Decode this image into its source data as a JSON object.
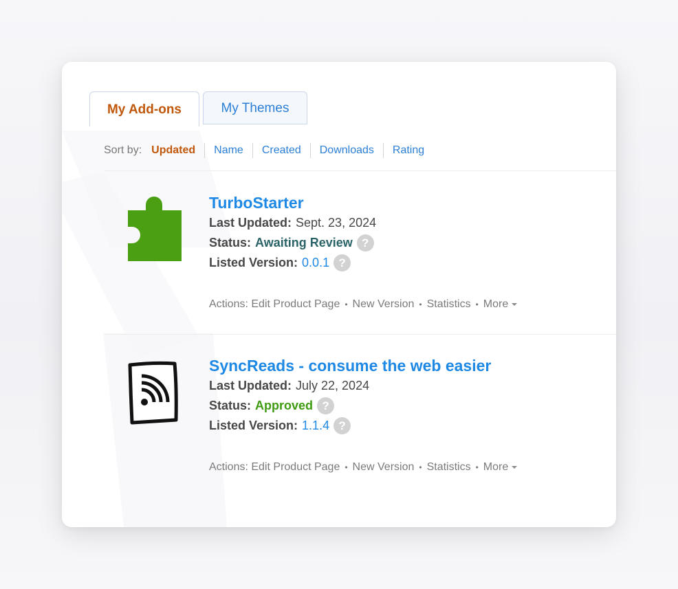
{
  "tabs": {
    "addons_label": "My Add-ons",
    "themes_label": "My Themes"
  },
  "sort": {
    "label": "Sort by:",
    "items": [
      "Updated",
      "Name",
      "Created",
      "Downloads",
      "Rating"
    ]
  },
  "addons": [
    {
      "title": "TurboStarter",
      "updated_label": "Last Updated:",
      "updated_value": "Sept. 23, 2024",
      "status_label": "Status:",
      "status_value": "Awaiting Review",
      "version_label": "Listed Version:",
      "version_value": "0.0.1",
      "icon": "puzzle-piece-icon",
      "actions": {
        "prefix": "Actions:",
        "edit": "Edit Product Page",
        "new_version": "New Version",
        "statistics": "Statistics",
        "more": "More"
      }
    },
    {
      "title": "SyncReads - consume the web easier",
      "updated_label": "Last Updated:",
      "updated_value": "July 22, 2024",
      "status_label": "Status:",
      "status_value": "Approved",
      "version_label": "Listed Version:",
      "version_value": "1.1.4",
      "icon": "rss-feed-icon",
      "actions": {
        "prefix": "Actions:",
        "edit": "Edit Product Page",
        "new_version": "New Version",
        "statistics": "Statistics",
        "more": "More"
      }
    }
  ],
  "help_glyph": "?",
  "colors": {
    "accent_orange": "#c0570a",
    "link_blue": "#1e88e5",
    "status_awaiting": "#2b6468",
    "status_approved": "#3f9b12",
    "puzzle_green": "#4a9f12"
  }
}
